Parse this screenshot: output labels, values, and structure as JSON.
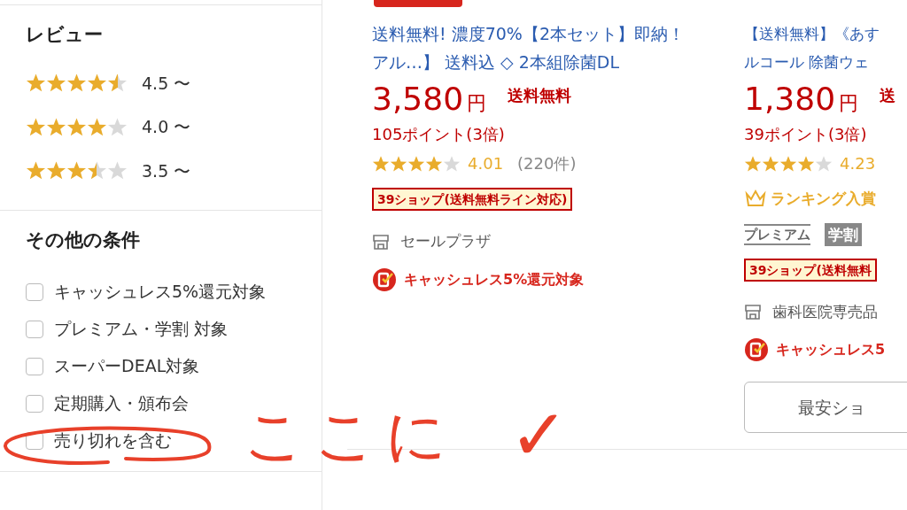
{
  "sidebar": {
    "review": {
      "title": "レビュー",
      "options": [
        {
          "stars": 4.5,
          "label": "4.5 〜"
        },
        {
          "stars": 4,
          "label": "4.0 〜"
        },
        {
          "stars": 3.5,
          "label": "3.5 〜"
        }
      ]
    },
    "conditions": {
      "title": "その他の条件",
      "options": [
        {
          "label": "キャッシュレス5%還元対象",
          "checked": false
        },
        {
          "label": "プレミアム・学割 対象",
          "checked": false
        },
        {
          "label": "スーパーDEAL対象",
          "checked": false
        },
        {
          "label": "定期購入・頒布会",
          "checked": false
        },
        {
          "label": "売り切れを含む",
          "checked": false
        }
      ]
    }
  },
  "products": [
    {
      "title": "送料無料! 濃度70%【2本セット】即納！アル…】 送料込 ◇ 2本組除菌DL",
      "price": "3,580",
      "currency": "円",
      "shipping": "送料無料",
      "points": "105ポイント(3倍)",
      "stars": 4,
      "rating": "4.01",
      "reviews": "(220件)",
      "badges": [
        {
          "kind": "shop39",
          "label": "39ショップ(送料無料ライン対応)"
        }
      ],
      "shop": "セールプラザ",
      "cashless": "キャッシュレス5%還元対象"
    },
    {
      "title_lines": [
        "【送料無料】《あす",
        "ルコール 除菌ウェ"
      ],
      "price": "1,380",
      "currency": "円",
      "shipping": "送",
      "points": "39ポイント(3倍)",
      "stars": 4,
      "rating": "4.23",
      "badges": [
        {
          "kind": "ranking",
          "label": "ランキング入賞"
        },
        {
          "kind": "premium",
          "label": "プレミアム",
          "label2": "学割"
        },
        {
          "kind": "shop39",
          "label": "39ショップ(送料無料"
        }
      ],
      "shop": "歯科医院専売品",
      "cashless": "キャッシュレス5",
      "button": "最安ショ"
    }
  ],
  "annotation": {
    "text": "ここに",
    "mark": "✓"
  }
}
